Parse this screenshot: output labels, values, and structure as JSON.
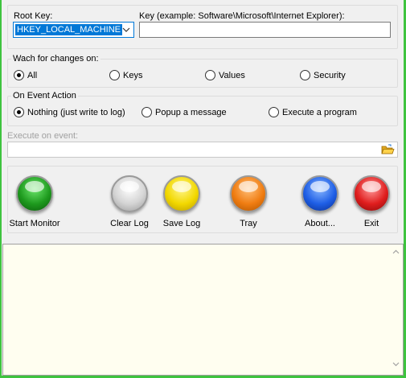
{
  "registry": {
    "root_key_label": "Root Key:",
    "root_key_value": "HKEY_LOCAL_MACHINE",
    "key_label": "Key (example: Software\\Microsoft\\Internet Explorer):",
    "key_value": ""
  },
  "watch_changes": {
    "caption": "Wach for changes on:",
    "options": [
      {
        "label": "All",
        "checked": true
      },
      {
        "label": "Keys",
        "checked": false
      },
      {
        "label": "Values",
        "checked": false
      },
      {
        "label": "Security",
        "checked": false
      }
    ]
  },
  "event_action": {
    "caption": "On Event Action",
    "options": [
      {
        "label": "Nothing (just write to log)",
        "checked": true
      },
      {
        "label": "Popup a message",
        "checked": false
      },
      {
        "label": "Execute a program",
        "checked": false
      }
    ]
  },
  "execute": {
    "label": "Execute on event:",
    "value": ""
  },
  "toolbar": {
    "buttons": [
      {
        "label": "Start Monitor",
        "color": "#1e9a1e"
      },
      {
        "label": "Clear Log",
        "color": "#d4d4d4"
      },
      {
        "label": "Save Log",
        "color": "#f2d800"
      },
      {
        "label": "Tray",
        "color": "#f07d12"
      },
      {
        "label": "About...",
        "color": "#1f5fe6"
      },
      {
        "label": "Exit",
        "color": "#e01e1e"
      }
    ]
  },
  "log": {
    "content": "",
    "background": "#fffef0"
  }
}
